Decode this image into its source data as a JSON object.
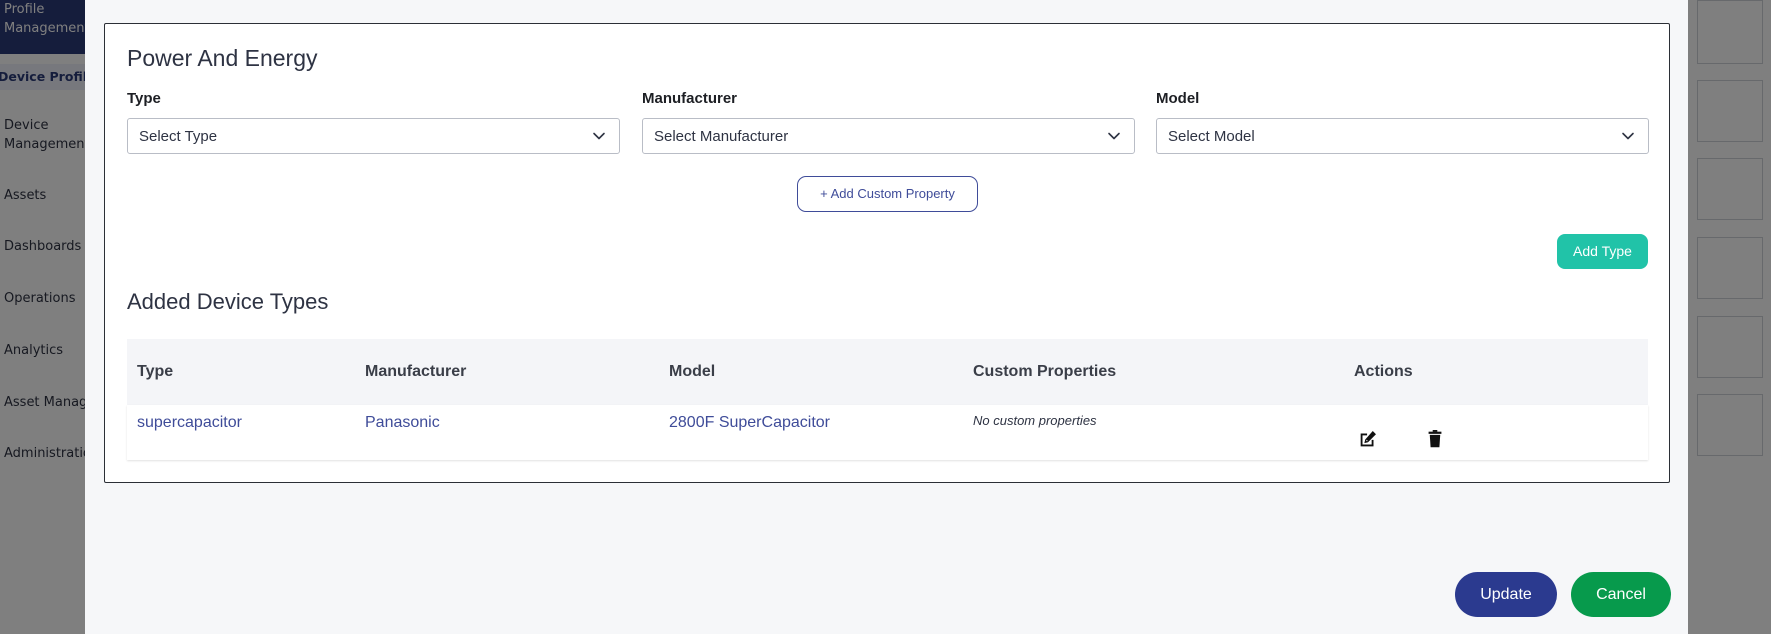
{
  "sidebar": {
    "profile_management": "Profile Management",
    "device_profiles": "Device Profiles",
    "items": [
      {
        "label": "Device Management"
      },
      {
        "label": "Assets"
      },
      {
        "label": "Dashboards"
      },
      {
        "label": "Operations"
      },
      {
        "label": "Analytics"
      },
      {
        "label": "Asset Management"
      },
      {
        "label": "Administration"
      }
    ]
  },
  "modal": {
    "section_title": "Power And Energy",
    "fields": {
      "type": {
        "label": "Type",
        "placeholder": "Select Type"
      },
      "manufacturer": {
        "label": "Manufacturer",
        "placeholder": "Select Manufacturer"
      },
      "model": {
        "label": "Model",
        "placeholder": "Select Model"
      }
    },
    "add_custom_property": "+ Add Custom Property",
    "add_type": "Add Type",
    "added_title": "Added Device Types",
    "table": {
      "headers": [
        "Type",
        "Manufacturer",
        "Model",
        "Custom Properties",
        "Actions"
      ],
      "rows": [
        {
          "type": "supercapacitor",
          "manufacturer": "Panasonic",
          "model": "2800F SuperCapacitor",
          "custom_properties": "No custom properties"
        }
      ]
    },
    "update": "Update",
    "cancel": "Cancel"
  },
  "colors": {
    "primary": "#2b3a8f",
    "teal": "#21c3a8",
    "green": "#079a4c",
    "link": "#3f4c99"
  }
}
